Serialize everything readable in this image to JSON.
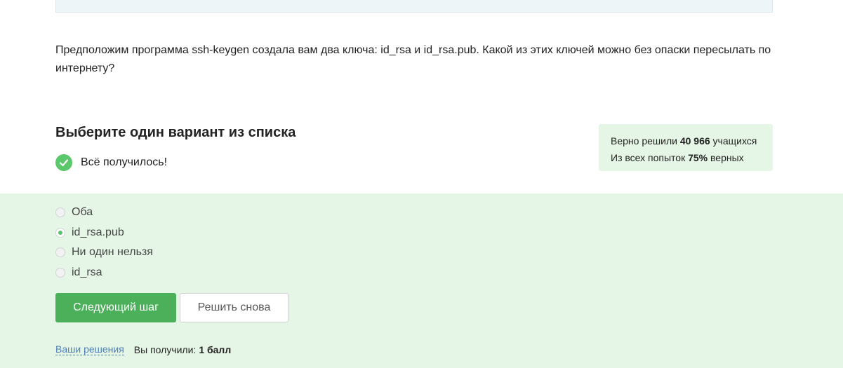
{
  "question": {
    "text": "Предположим программа ssh-keygen создала вам два ключа: id_rsa и id_rsa.pub. Какой из этих ключей можно без опаски пересылать по интернету?"
  },
  "quiz": {
    "title": "Выберите один вариант из списка",
    "success_message": "Всё получилось!"
  },
  "stats": {
    "solved_prefix": "Верно решили",
    "solved_count": "40 966",
    "solved_suffix": "учащихся",
    "attempts_prefix": "Из всех попыток",
    "attempts_percent": "75%",
    "attempts_suffix": "верных"
  },
  "options": [
    {
      "label": "Оба",
      "selected": false
    },
    {
      "label": "id_rsa.pub",
      "selected": true
    },
    {
      "label": "Ни один нельзя",
      "selected": false
    },
    {
      "label": "id_rsa",
      "selected": false
    }
  ],
  "buttons": {
    "next_label": "Следующий шаг",
    "retry_label": "Решить снова"
  },
  "footer": {
    "solutions_link": "Ваши решения",
    "score_prefix": "Вы получили:",
    "score_value": "1 балл"
  },
  "colors": {
    "accent_green": "#4cb05a",
    "success_bg": "#e6f6e6",
    "link_blue": "#4a7fb8"
  }
}
